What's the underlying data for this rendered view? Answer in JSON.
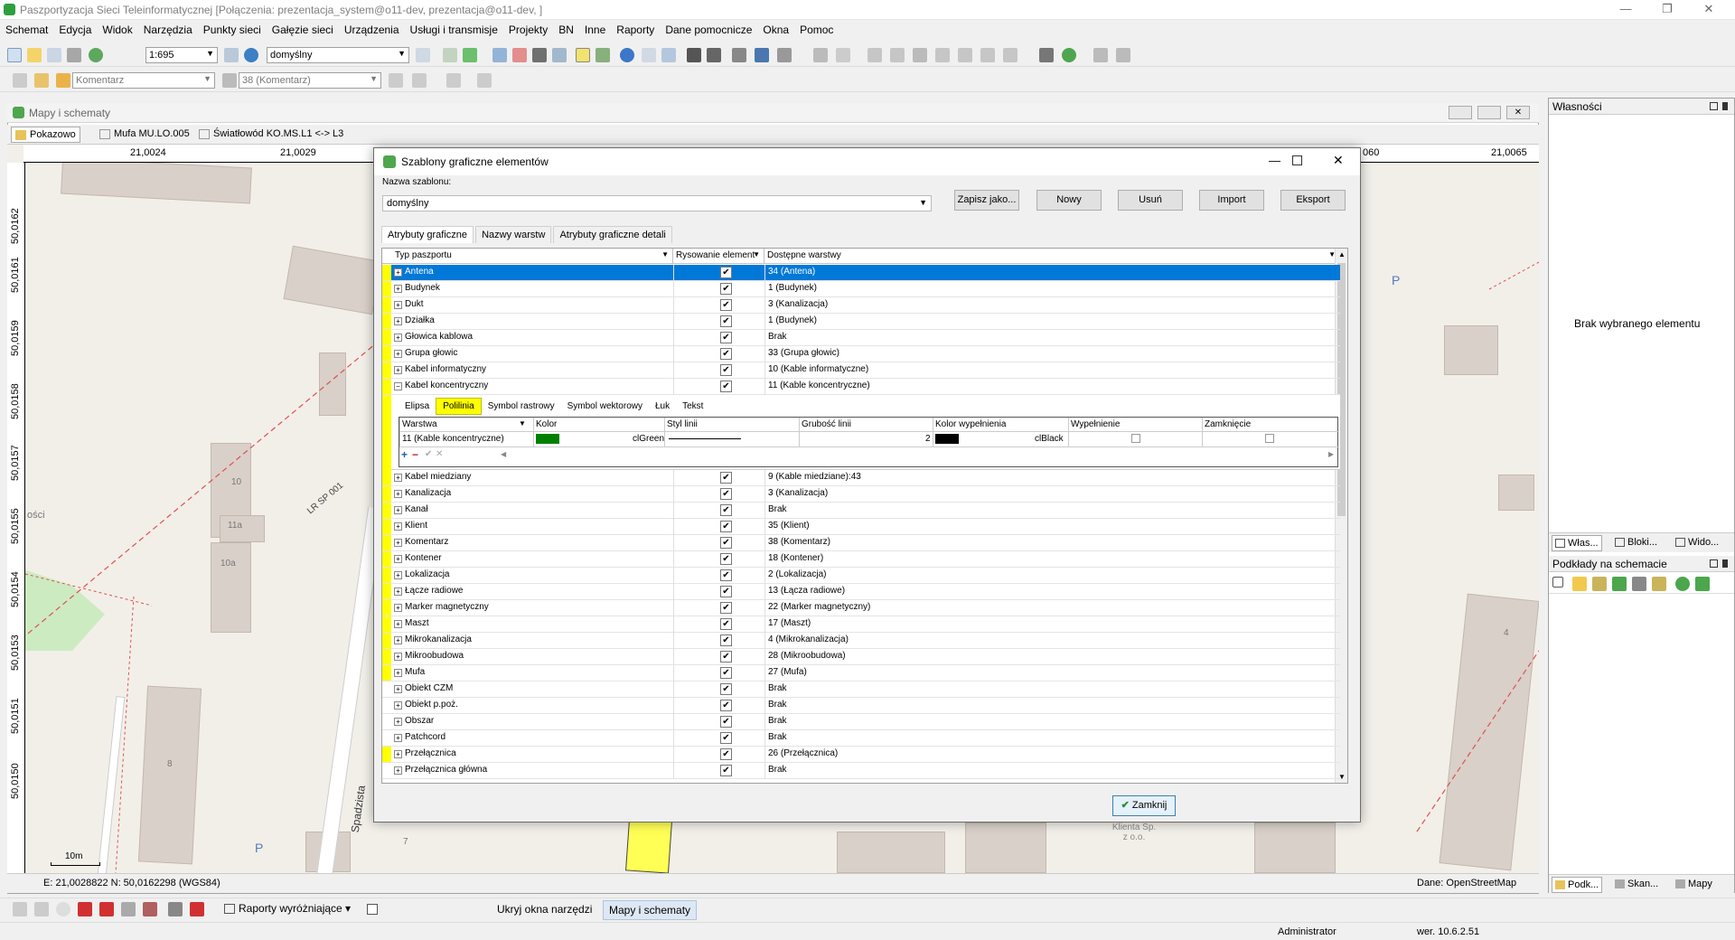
{
  "window": {
    "title": "Paszportyzacja Sieci Teleinformatycznej [Połączenia: prezentacja_system@o11-dev, prezentacja@o11-dev, ]"
  },
  "menu": [
    "Schemat",
    "Edycja",
    "Widok",
    "Narzędzia",
    "Punkty sieci",
    "Gałęzie sieci",
    "Urządzenia",
    "Usługi i transmisje",
    "Projekty",
    "BN",
    "Inne",
    "Raporty",
    "Dane pomocnicze",
    "Okna",
    "Pomoc"
  ],
  "toolbar": {
    "scale": "1:695",
    "template": "domyślny",
    "layer_combo": "Komentarz",
    "layer_combo2": "38 (Komentarz)"
  },
  "mdi": {
    "title": "Mapy i schematy",
    "tabs": [
      "Pokazowo",
      "Mufa MU.LO.005",
      "Światłowód KO.MS.L1 <-> L3"
    ]
  },
  "ruler": {
    "top": [
      "21,0024",
      "21,0029",
      "060",
      "21,0065"
    ],
    "left": [
      "50,0162",
      "50,0161",
      "50,0159",
      "50,0158",
      "50,0157",
      "50,0155",
      "50,0154",
      "50,0153",
      "50,0151",
      "50,0150"
    ]
  },
  "map": {
    "labels": [
      "10",
      "11a",
      "10a",
      "8",
      "7",
      "4",
      "Spadzista",
      "LR SP 001",
      "P",
      "P",
      "Klienta Sp. z o.o.",
      "ości"
    ],
    "scale_bar": "10m",
    "coords": "E: 21,0028822  N: 50,0162298 (WGS84)",
    "data_source": "Dane: OpenStreetMap"
  },
  "right_panel": {
    "title": "Własności",
    "empty_text": "Brak wybranego elementu",
    "tabs": [
      "Włas...",
      "Bloki...",
      "Wido..."
    ],
    "panel2_title": "Podkłady na schemacie",
    "panel2_tabs": [
      "Podk...",
      "Skan...",
      "Mapy"
    ]
  },
  "dialog": {
    "title": "Szablony graficzne elementów",
    "template_label": "Nazwa szablonu:",
    "template_value": "domyślny",
    "buttons": [
      "Zapisz jako...",
      "Nowy",
      "Usuń",
      "Import",
      "Eksport"
    ],
    "tabs": [
      "Atrybuty graficzne",
      "Nazwy warstw",
      "Atrybuty graficzne detali"
    ],
    "columns": [
      "Typ paszportu",
      "Rysowanie element",
      "Dostępne warstwy"
    ],
    "close_button": "Zamknij",
    "rows_before": [
      {
        "name": "Antena",
        "layer": "34 (Antena)",
        "selected": true
      },
      {
        "name": "Budynek",
        "layer": "1 (Budynek)"
      },
      {
        "name": "Dukt",
        "layer": "3 (Kanalizacja)"
      },
      {
        "name": "Działka",
        "layer": "1 (Budynek)"
      },
      {
        "name": "Głowica kablowa",
        "layer": "Brak"
      },
      {
        "name": "Grupa głowic",
        "layer": "33 (Grupa głowic)"
      },
      {
        "name": "Kabel informatyczny",
        "layer": "10 (Kable informatyczne)"
      },
      {
        "name": "Kabel koncentryczny",
        "layer": "11 (Kable koncentryczne)",
        "expanded": true
      }
    ],
    "detail": {
      "subtabs": [
        "Elipsa",
        "Polilinia",
        "Symbol rastrowy",
        "Symbol wektorowy",
        "Łuk",
        "Tekst"
      ],
      "columns": [
        "Warstwa",
        "Kolor",
        "Styl linii",
        "Grubość linii",
        "Kolor wypełnienia",
        "Wypełnienie",
        "Zamknięcie"
      ],
      "row": {
        "layer": "11 (Kable koncentryczne)",
        "color": "clGreen",
        "width": "2",
        "fill": "clBlack"
      },
      "colors": {
        "green": "#008000",
        "black": "#000000"
      }
    },
    "rows_after": [
      {
        "name": "Kabel miedziany",
        "layer": "9 (Kable miedziane):43"
      },
      {
        "name": "Kanalizacja",
        "layer": "3 (Kanalizacja)"
      },
      {
        "name": "Kanał",
        "layer": "Brak"
      },
      {
        "name": "Klient",
        "layer": "35 (Klient)"
      },
      {
        "name": "Komentarz",
        "layer": "38 (Komentarz)"
      },
      {
        "name": "Kontener",
        "layer": "18 (Kontener)"
      },
      {
        "name": "Lokalizacja",
        "layer": "2 (Lokalizacja)"
      },
      {
        "name": "Łącze radiowe",
        "layer": "13 (Łącza radiowe)"
      },
      {
        "name": "Marker magnetyczny",
        "layer": "22 (Marker magnetyczny)"
      },
      {
        "name": "Maszt",
        "layer": "17 (Maszt)"
      },
      {
        "name": "Mikrokanalizacja",
        "layer": "4 (Mikrokanalizacja)"
      },
      {
        "name": "Mikroobudowa",
        "layer": "28 (Mikroobudowa)"
      },
      {
        "name": "Mufa",
        "layer": "27 (Mufa)"
      },
      {
        "name": "Obiekt CZM",
        "layer": "Brak",
        "nomark": true
      },
      {
        "name": "Obiekt p.poż.",
        "layer": "Brak",
        "nomark": true
      },
      {
        "name": "Obszar",
        "layer": "Brak",
        "nomark": true
      },
      {
        "name": "Patchcord",
        "layer": "Brak",
        "nomark": true
      },
      {
        "name": "Przełącznica",
        "layer": "26 (Przełącznica)"
      },
      {
        "name": "Przełącznica główna",
        "layer": "Brak",
        "nomark": true
      }
    ]
  },
  "bottom": {
    "reports": "Raporty wyróżniające",
    "hide": "Ukryj okna narzędzi",
    "maps": "Mapy i schematy",
    "user": "Administrator",
    "version": "wer. 10.6.2.51"
  }
}
